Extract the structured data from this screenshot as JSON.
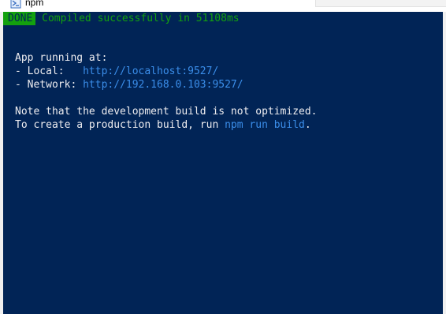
{
  "window": {
    "title": "npm",
    "icon": "powershell-icon"
  },
  "console": {
    "done_badge": "DONE",
    "compiled_message": " Compiled successfully in 51108ms",
    "app_running": "App running at:",
    "local_label": "- Local:   ",
    "local_url": "http://localhost:9527/",
    "network_label": "- Network: ",
    "network_url": "http://192.168.0.103:9527/",
    "note_line": "Note that the development build is not optimized.",
    "production_prefix": "To create a production build, run ",
    "production_cmd": "npm run build",
    "production_suffix": "."
  },
  "colors": {
    "background": "#012456",
    "foreground": "#eeedf0",
    "success": "#13a10e",
    "link": "#3b8eea"
  }
}
